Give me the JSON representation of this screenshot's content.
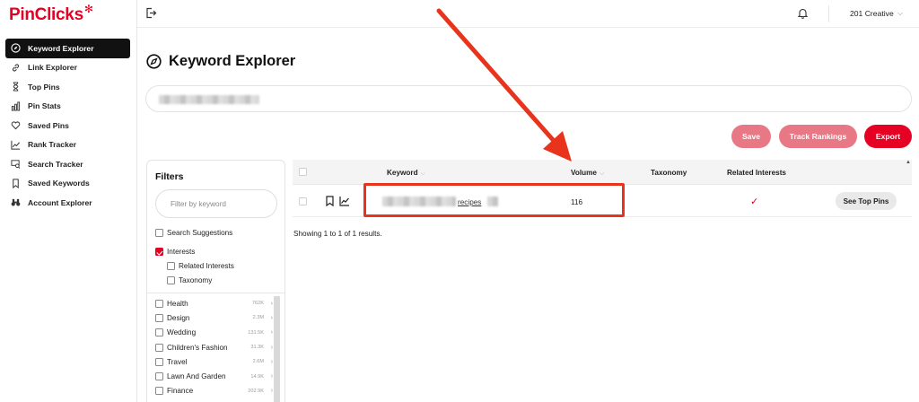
{
  "app": {
    "logo": "PinClicks",
    "brand_color": "#e60023"
  },
  "sidebar": {
    "items": [
      {
        "label": "Keyword Explorer",
        "icon": "compass-icon",
        "active": true
      },
      {
        "label": "Link Explorer",
        "icon": "link-icon",
        "active": false
      },
      {
        "label": "Top Pins",
        "icon": "hourglass-icon",
        "active": false
      },
      {
        "label": "Pin Stats",
        "icon": "bar-chart-icon",
        "active": false
      },
      {
        "label": "Saved Pins",
        "icon": "heart-icon",
        "active": false
      },
      {
        "label": "Rank Tracker",
        "icon": "line-chart-icon",
        "active": false
      },
      {
        "label": "Search Tracker",
        "icon": "search-tracker-icon",
        "active": false
      },
      {
        "label": "Saved Keywords",
        "icon": "bookmark-icon",
        "active": false
      },
      {
        "label": "Account Explorer",
        "icon": "binoculars-icon",
        "active": false
      }
    ]
  },
  "topbar": {
    "account_name": "201 Creative",
    "caret": "⌵"
  },
  "page": {
    "title": "Keyword Explorer"
  },
  "toolbar": {
    "save_label": "Save",
    "track_label": "Track Rankings",
    "export_label": "Export"
  },
  "filters": {
    "title": "Filters",
    "search_placeholder": "Filter by keyword",
    "options": [
      {
        "label": "Search Suggestions",
        "checked": false
      },
      {
        "label": "Interests",
        "checked": true
      },
      {
        "label": "Related Interests",
        "checked": false
      },
      {
        "label": "Taxonomy",
        "checked": false
      }
    ],
    "categories": [
      {
        "label": "Health",
        "count": "762K"
      },
      {
        "label": "Design",
        "count": "2.3M"
      },
      {
        "label": "Wedding",
        "count": "131.5K"
      },
      {
        "label": "Children's Fashion",
        "count": "31.3K"
      },
      {
        "label": "Travel",
        "count": "2.6M"
      },
      {
        "label": "Lawn And Garden",
        "count": "14.9K"
      },
      {
        "label": "Finance",
        "count": "202.9K"
      }
    ]
  },
  "table": {
    "columns": {
      "keyword": "Keyword",
      "volume": "Volume",
      "taxonomy": "Taxonomy",
      "related": "Related Interests"
    },
    "rows": [
      {
        "keyword_visible": "recipes",
        "volume": "116",
        "related_check": "✓",
        "action": "See Top Pins"
      }
    ],
    "results_text": "Showing 1 to 1 of 1 results."
  },
  "annotation": {
    "color": "#e8341c"
  }
}
